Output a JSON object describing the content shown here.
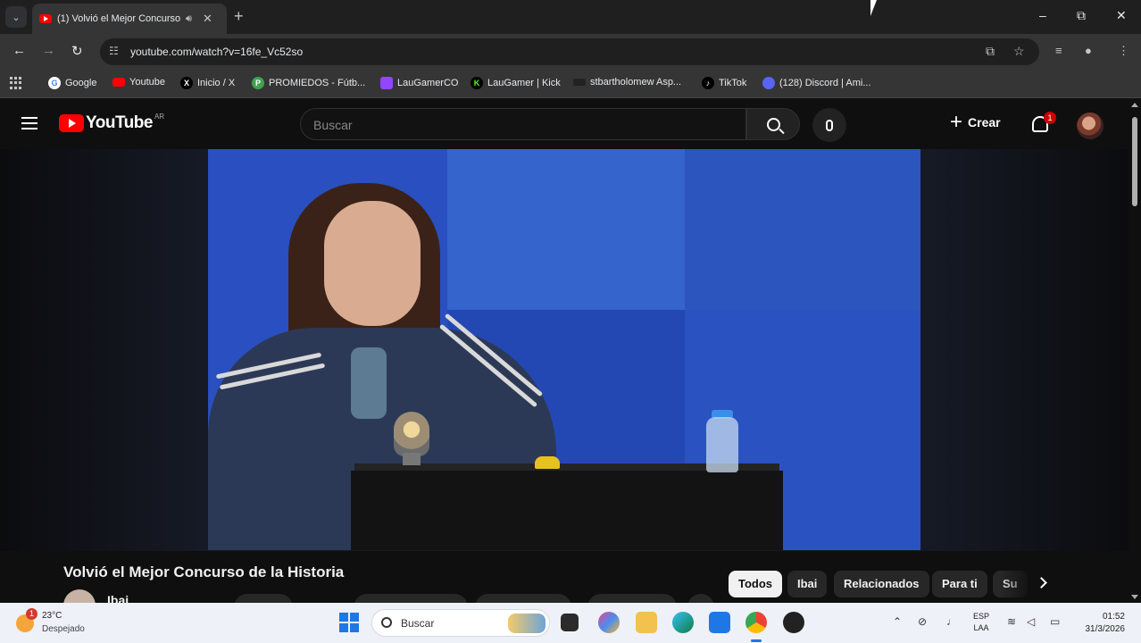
{
  "browser": {
    "tab": {
      "title": "(1) Volvió el Mejor Concurso de la Historia",
      "audio_icon": "speaker-icon",
      "close_glyph": "✕"
    },
    "new_tab_glyph": "+",
    "url": "youtube.com/watch?v=16fe_Vc52so",
    "window_controls": {
      "minimize": "–",
      "maximize": "⧉",
      "close": "✕"
    },
    "bookmarks": [
      {
        "label": "Google",
        "icon": "google-icon",
        "color": "#ffffff"
      },
      {
        "label": "Youtube",
        "icon": "youtube-icon",
        "color": "#ff0000"
      },
      {
        "label": "Inicio / X",
        "icon": "x-icon",
        "color": "#000000"
      },
      {
        "label": "PROMIEDOS - Fútb...",
        "icon": "promiedos-icon",
        "color": "#3fa34d"
      },
      {
        "label": "LauGamerCO",
        "icon": "twitch-icon",
        "color": "#9146ff"
      },
      {
        "label": "LauGamer | Kick",
        "icon": "kick-icon",
        "color": "#53fc18"
      },
      {
        "label": "stbartholomew Asp...",
        "icon": "asp-icon",
        "color": "#222222"
      },
      {
        "label": "TikTok",
        "icon": "tiktok-icon",
        "color": "#000000"
      },
      {
        "label": "(128) Discord | Ami...",
        "icon": "discord-icon",
        "color": "#5865f2"
      }
    ]
  },
  "youtube": {
    "logo_text": "YouTube",
    "country_code": "AR",
    "search_placeholder": "Buscar",
    "create_label": "Crear",
    "notification_count": "1",
    "video_title": "Volvió el Mejor Concurso de la Historia",
    "channel_name": "Ibai",
    "chips": [
      {
        "label": "Todos",
        "active": true
      },
      {
        "label": "Ibai",
        "active": false
      },
      {
        "label": "Relacionados",
        "active": false
      },
      {
        "label": "Para ti",
        "active": false
      },
      {
        "label": "Su",
        "active": false
      }
    ]
  },
  "taskbar": {
    "weather": {
      "temp": "23°C",
      "condition": "Despejado",
      "badge": "1"
    },
    "search_label": "Buscar",
    "lang_line1": "ESP",
    "lang_line2": "LAA",
    "time": "01:52",
    "date": "31/3/2026"
  },
  "colors": {
    "accent_red": "#ff0000",
    "youtube_bg": "#0f0f0f",
    "taskbar_bg": "#eef1f7",
    "windows_blue": "#1f77e6"
  }
}
